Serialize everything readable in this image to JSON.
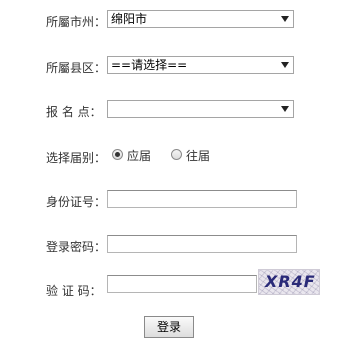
{
  "form": {
    "city": {
      "label": "所屬市州：",
      "selected": "绵阳市"
    },
    "county": {
      "label": "所屬县区：",
      "selected": "==请选择=="
    },
    "site": {
      "label": "报 名 点：",
      "selected": ""
    },
    "grad_year": {
      "label": "选择届别：",
      "options": [
        {
          "label": "应届",
          "checked": true
        },
        {
          "label": "往届",
          "checked": false
        }
      ]
    },
    "id_number": {
      "label": "身份证号：",
      "value": ""
    },
    "password": {
      "label": "登录密码：",
      "value": ""
    },
    "captcha": {
      "label": "验 证 码：",
      "value": "",
      "image_text": "XR4F"
    },
    "submit_label": "登录"
  }
}
